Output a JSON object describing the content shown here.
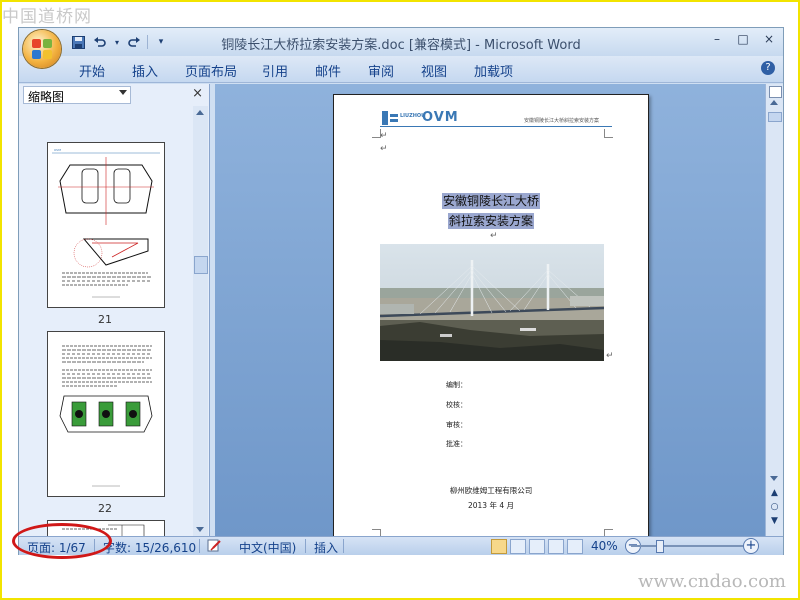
{
  "watermark_top": "中国道桥网",
  "watermark_bottom": "www.cndao.com",
  "window": {
    "title": "铜陵长江大桥拉索安装方案.doc [兼容模式] - Microsoft Word",
    "quick_access": [
      "save-icon",
      "undo-icon",
      "redo-icon",
      "customize-icon"
    ],
    "controls": {
      "minimize": "–",
      "maximize": "□",
      "close": "×"
    },
    "ribbon_tabs": [
      "开始",
      "插入",
      "页面布局",
      "引用",
      "邮件",
      "审阅",
      "视图",
      "加载项"
    ],
    "help": "?"
  },
  "thumbnail_pane": {
    "view_label": "缩略图",
    "close": "×",
    "pages": [
      {
        "number": "21"
      },
      {
        "number": "22"
      },
      {
        "number": ""
      }
    ]
  },
  "document": {
    "header_brand": "OVM",
    "header_sub": "LIUZHOU",
    "header_right": "安徽铜陵长江大桥斜拉索安装方案",
    "return_mark": "↵",
    "title_line1": "安徽铜陵长江大桥",
    "title_line2": "斜拉索安装方案",
    "sign_rows": [
      "编制：",
      "校核：",
      "审核：",
      "批准："
    ],
    "company": "柳州欧维姆工程有限公司",
    "date": "2013 年 4 月"
  },
  "statusbar": {
    "page_info": "页面: 1/67",
    "word_count": "字数: 15/26,610",
    "language": "中文(中国)",
    "mode": "插入",
    "zoom": "40%",
    "zoom_minus": "−",
    "zoom_plus": "+",
    "zoom_percent": 40
  },
  "colors": {
    "frame": "#f2e400",
    "highlight": "#9aa7cf",
    "annotation": "#d01818"
  }
}
